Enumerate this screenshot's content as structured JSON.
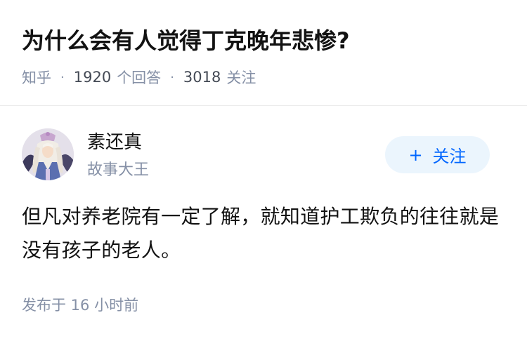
{
  "question": {
    "title": "为什么会有人觉得丁克晚年悲惨?",
    "source": "知乎",
    "answer_count": "1920",
    "answer_label": "个回答",
    "follower_count": "3018",
    "follower_label": "关注",
    "separator": "·"
  },
  "answer": {
    "author": {
      "name": "素还真",
      "badge": "故事大王",
      "avatar_icon": "anime-character-avatar"
    },
    "follow_button": {
      "icon": "+",
      "label": "关注"
    },
    "content": "但凡对养老院有一定了解，就知道护工欺负的往往就是没有孩子的老人。",
    "time": "发布于 16 小时前"
  },
  "colors": {
    "title": "#121212",
    "meta": "#8590a6",
    "accent": "#0066ff",
    "follow_bg": "#ebf5fd"
  }
}
